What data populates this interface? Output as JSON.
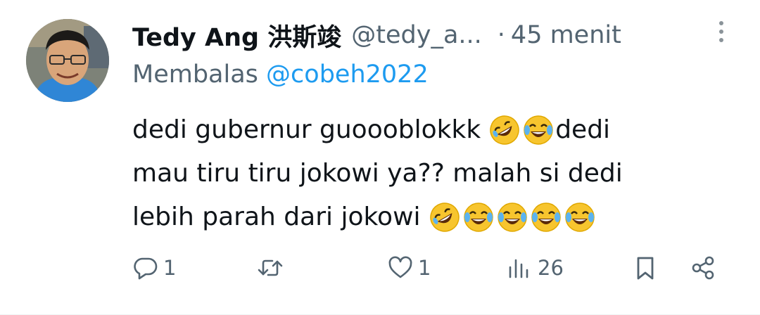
{
  "tweet": {
    "author_name": "Tedy Ang 洪斯竣",
    "author_handle": "@tedy_a...",
    "separator": "·",
    "time": "45 menit",
    "reply_prefix": "Membalas",
    "reply_to": "@cobeh2022",
    "text_line1": "dedi gubernur guoooblokkk",
    "text_line1_tail": "dedi",
    "text_line2": "mau tiru tiru jokowi ya?? malah si dedi",
    "text_line3": "lebih parah dari jokowi",
    "emojis_line1": [
      "rolling-on-floor-laughing",
      "face-with-tears-of-joy"
    ],
    "emojis_line3": [
      "rolling-on-floor-laughing",
      "face-with-tears-of-joy",
      "face-with-tears-of-joy",
      "face-with-tears-of-joy",
      "face-with-tears-of-joy"
    ]
  },
  "actions": {
    "reply_count": "1",
    "retweet_count": "",
    "like_count": "1",
    "views_count": "26"
  },
  "icons": {
    "reply": "reply-icon",
    "retweet": "retweet-icon",
    "like": "heart-icon",
    "views": "views-icon",
    "bookmark": "bookmark-icon",
    "share": "share-icon",
    "more": "more-vertical-icon"
  },
  "colors": {
    "text": "#0f1419",
    "secondary": "#536471",
    "link": "#1d9bf0",
    "emoji": "#f7c52e"
  }
}
